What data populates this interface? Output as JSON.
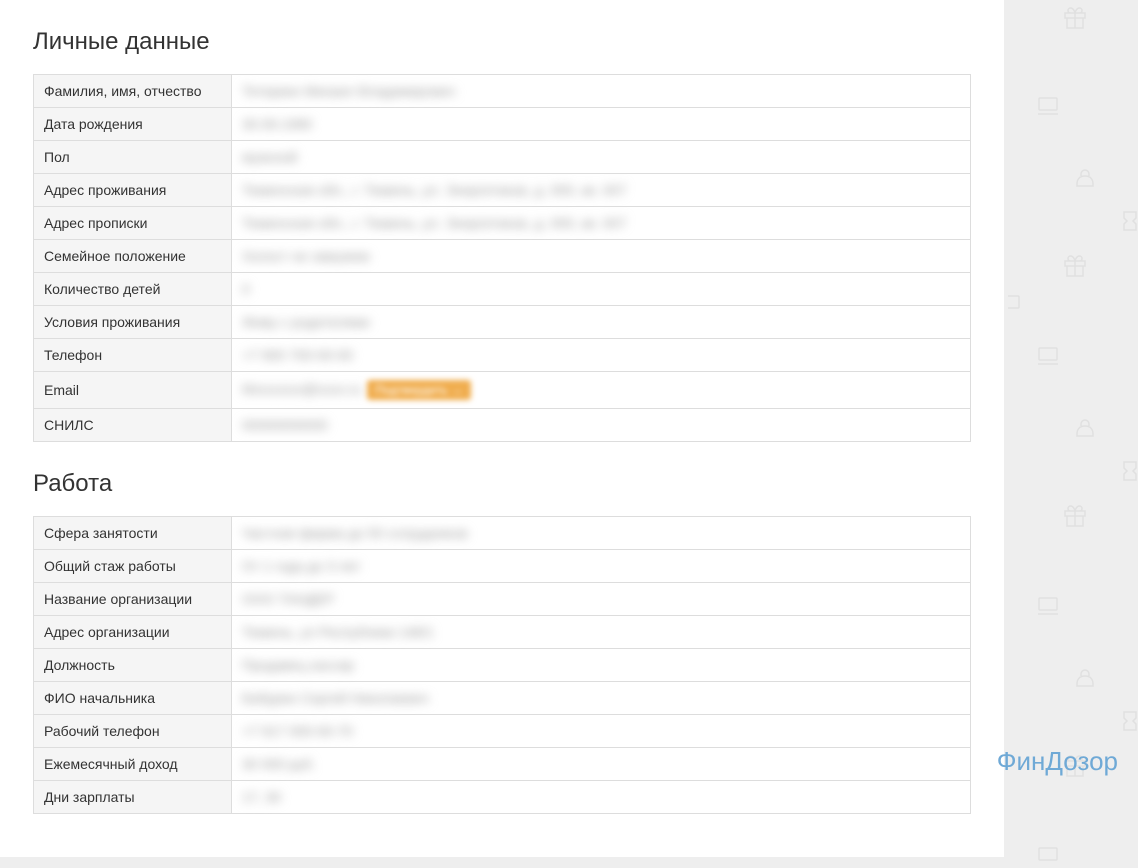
{
  "sections": {
    "personal": {
      "title": "Личные данные",
      "rows": [
        {
          "label": "Фамилия, имя, отчество",
          "value": "Тетеркин Михаил Владимирович"
        },
        {
          "label": "Дата рождения",
          "value": "30.09.1990"
        },
        {
          "label": "Пол",
          "value": "мужской"
        },
        {
          "label": "Адрес проживания",
          "value": "Тюменская обл., г. Тюмень, ул. Энергетиков, д. 000, кв. 007"
        },
        {
          "label": "Адрес прописки",
          "value": "Тюменская обл., г. Тюмень, ул. Энергетиков, д. 000, кв. 007"
        },
        {
          "label": "Семейное положение",
          "value": "Холост не замужем"
        },
        {
          "label": "Количество детей",
          "value": "0"
        },
        {
          "label": "Условия проживания",
          "value": "Живу с родителями"
        },
        {
          "label": "Телефон",
          "value": "+7 900 700-00-00"
        },
        {
          "label": "Email",
          "value": "Mxxxxxxx@xxxx.ru",
          "badge": "Подтвердить →"
        },
        {
          "label": "СНИЛС",
          "value": "00000000000"
        }
      ]
    },
    "work": {
      "title": "Работа",
      "rows": [
        {
          "label": "Сфера занятости",
          "value": "Частная фирма до 50 сотрудников"
        },
        {
          "label": "Общий стаж работы",
          "value": "От 1 года до 3 лет"
        },
        {
          "label": "Название организации",
          "value": "ООО ТАНДЕР"
        },
        {
          "label": "Адрес организации",
          "value": "Тюмень, ул Республики 148/1"
        },
        {
          "label": "Должность",
          "value": "Продавец кассир"
        },
        {
          "label": "ФИО начальника",
          "value": "Бабурин Сергей Николаевич"
        },
        {
          "label": "Рабочий телефон",
          "value": "+7 917 000-00-70"
        },
        {
          "label": "Ежемесячный доход",
          "value": "30 000 руб."
        },
        {
          "label": "Дни зарплаты",
          "value": "17, 30"
        }
      ]
    }
  },
  "watermark": "ФинДозор"
}
